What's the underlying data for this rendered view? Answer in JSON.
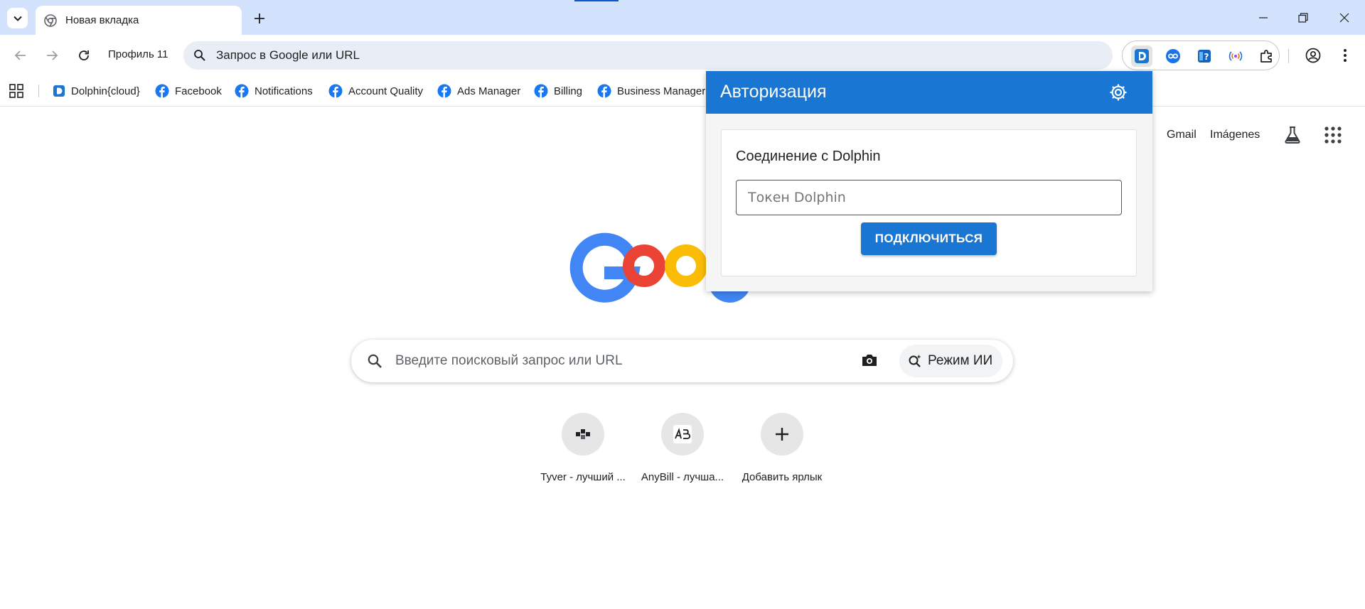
{
  "tab": {
    "title": "Новая вкладка"
  },
  "toolbar": {
    "profile_label": "Профиль 11",
    "omnibox_placeholder": "Запрос в Google или URL"
  },
  "bookmarks": [
    {
      "label": "Dolphin{cloud}",
      "icon": "dolphin-icon"
    },
    {
      "label": "Facebook",
      "icon": "facebook-icon"
    },
    {
      "label": "Notifications",
      "icon": "facebook-icon"
    },
    {
      "label": "Account Quality",
      "icon": "facebook-icon"
    },
    {
      "label": "Ads Manager",
      "icon": "facebook-icon"
    },
    {
      "label": "Billing",
      "icon": "facebook-icon"
    },
    {
      "label": "Business Manager",
      "icon": "facebook-icon"
    }
  ],
  "ntp": {
    "gmail_link": "Gmail",
    "images_link": "Imágenes",
    "search_placeholder": "Введите поисковый запрос или URL",
    "ai_mode_label": "Режим ИИ",
    "shortcuts": [
      {
        "label": "Tyver - лучший ..."
      },
      {
        "label": "AnyBill - лучша..."
      },
      {
        "label": "Добавить ярлык"
      }
    ]
  },
  "popup": {
    "title": "Авторизация",
    "card_title": "Соединение с Dolphin",
    "token_placeholder": "Токен Dolphin",
    "connect_label": "ПОДКЛЮЧИТЬСЯ"
  },
  "colors": {
    "tabstrip": "#d3e3fd",
    "popup_accent": "#1976d2",
    "facebook": "#1877f2"
  }
}
